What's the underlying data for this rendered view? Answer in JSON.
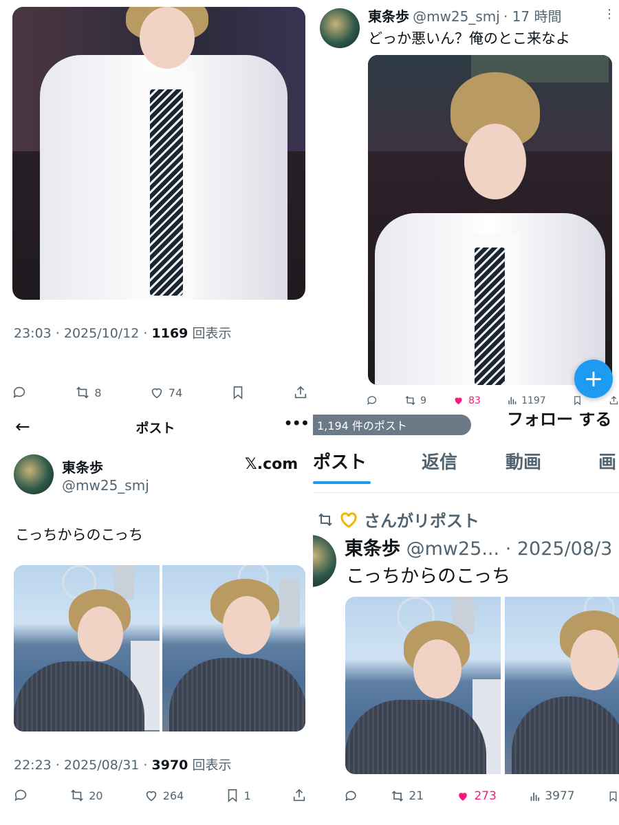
{
  "panel1": {
    "timestamp": "23:03 · 2025/10/12 · ",
    "views": "1169",
    "views_suffix": " 回表示",
    "retweets": "8",
    "likes": "74"
  },
  "panel2": {
    "name": "東条歩",
    "handle": "@mw25_smj",
    "age": "· 17 時間",
    "text": "どっか悪いん？俺のとこ来なよ",
    "retweets": "9",
    "likes": "83",
    "views": "1197",
    "fab": "+"
  },
  "panel3": {
    "header_title": "ポスト",
    "name": "東条歩",
    "handle": "@mw25_smj",
    "brand": "𝕏.com",
    "text": "こっちからのこっち",
    "timestamp": "22:23 · 2025/08/31 · ",
    "views": "3970",
    "views_suffix": " 回表示",
    "retweets": "20",
    "likes": "264",
    "bookmarks": "1"
  },
  "panel4": {
    "post_count": "1,194 件のポスト",
    "follow_partial": "フォロー する",
    "tabs": [
      "ポスト",
      "返信",
      "動画",
      "画"
    ],
    "repost_by": "さんがリポスト",
    "name": "東条歩",
    "handle": "@mw25...",
    "date": "· 2025/08/3",
    "text": "こっちからのこっち",
    "retweets": "21",
    "likes": "273",
    "views": "3977"
  },
  "colors": {
    "accent": "#1d9bf0",
    "like": "#f91880",
    "muted": "#536471"
  }
}
